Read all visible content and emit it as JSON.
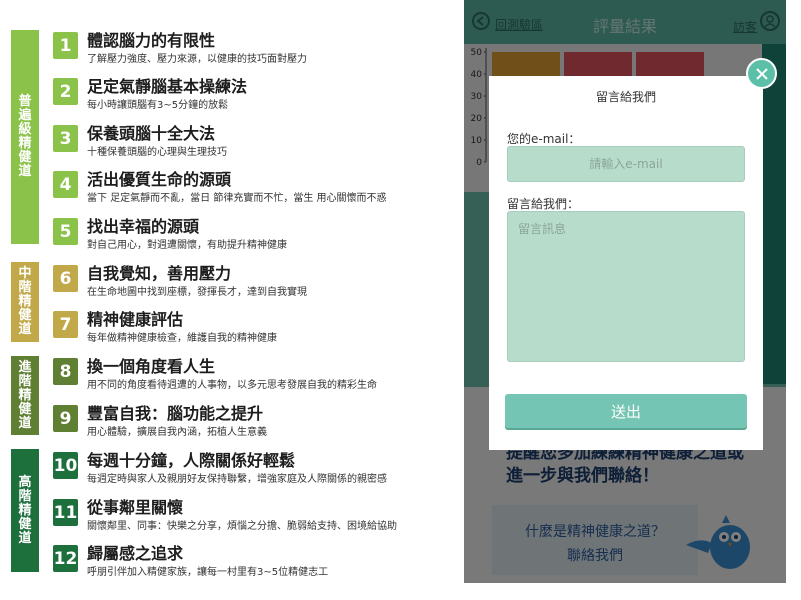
{
  "left": {
    "tiers": [
      {
        "label": "普遍級精健道",
        "color": "#8bc34a"
      },
      {
        "label": "中階精健道",
        "color": "#c1a94a"
      },
      {
        "label": "進階精健道",
        "color": "#5f7f32"
      },
      {
        "label": "高階精健道",
        "color": "#1d6f3c"
      }
    ],
    "items": [
      {
        "num": "1",
        "title": "體認腦力的有限性",
        "subtitle": "了解壓力強度、壓力來源，以健康的技巧面對壓力",
        "color": "#8bc34a"
      },
      {
        "num": "2",
        "title": "足定氣靜腦基本操練法",
        "subtitle": "每小時讓頭腦有3~5分鐘的放鬆",
        "color": "#8bc34a"
      },
      {
        "num": "3",
        "title": "保養頭腦十全大法",
        "subtitle": "十種保養頭腦的心理與生理技巧",
        "color": "#8bc34a"
      },
      {
        "num": "4",
        "title": "活出優質生命的源頭",
        "subtitle": "當下 足定氣靜而不亂，當日 節律充實而不忙，當生 用心關懷而不惑",
        "color": "#8bc34a"
      },
      {
        "num": "5",
        "title": "找出幸福的源頭",
        "subtitle": "對自己用心，對週遭關懷，有助提升精神健康",
        "color": "#8bc34a"
      },
      {
        "num": "6",
        "title": "自我覺知，善用壓力",
        "subtitle": "在生命地圖中找到座標，發揮長才，達到自我實現",
        "color": "#c1a94a"
      },
      {
        "num": "7",
        "title": "精神健康評估",
        "subtitle": "每年做精神健康檢查，維護自我的精神健康",
        "color": "#c1a94a"
      },
      {
        "num": "8",
        "title": "換一個角度看人生",
        "subtitle": "用不同的角度看待週遭的人事物，以多元思考發展自我的精彩生命",
        "color": "#5f7f32"
      },
      {
        "num": "9",
        "title": "豐富自我：腦功能之提升",
        "subtitle": "用心體驗，擴展自我內涵，拓植人生意義",
        "color": "#5f7f32"
      },
      {
        "num": "10",
        "title": "每週十分鐘，人際關係好輕鬆",
        "subtitle": "每週定時與家人及親朋好友保持聯繫，增強家庭及人際關係的親密感",
        "color": "#1d6f3c"
      },
      {
        "num": "11",
        "title": "從事鄰里關懷",
        "subtitle": "關懷鄰里、同事：快樂之分享，煩惱之分擔、脆弱給支持、困境給協助",
        "color": "#1d6f3c"
      },
      {
        "num": "12",
        "title": "歸屬感之追求",
        "subtitle": "呼朋引伴加入精健家族，讓每一村里有3~5位精健志工",
        "color": "#1d6f3c"
      }
    ]
  },
  "right": {
    "header": {
      "back_label": "回測驗區",
      "title": "評量結果",
      "visitor_label": "訪客"
    },
    "chart": {
      "y_ticks": [
        "50",
        "40",
        "30",
        "20",
        "10",
        "0"
      ],
      "bars": [
        {
          "value": 50,
          "color": "#e0a030"
        },
        {
          "value": 50,
          "color": "#e0555f"
        },
        {
          "value": 50,
          "color": "#e0555f"
        }
      ]
    },
    "lower": {
      "line1": "提醒您多加練練精神健康之道或",
      "line2": "進一步與我們聯絡！",
      "inquiry_q": "什麼是精神健康之道？",
      "inquiry_contact": "聯絡我們"
    },
    "modal": {
      "title": "留言給我們",
      "email_label": "您的e-mail：",
      "email_placeholder": "請輸入e-mail",
      "message_label": "留言給我們：",
      "message_placeholder": "留言訊息",
      "submit_label": "送出"
    }
  }
}
